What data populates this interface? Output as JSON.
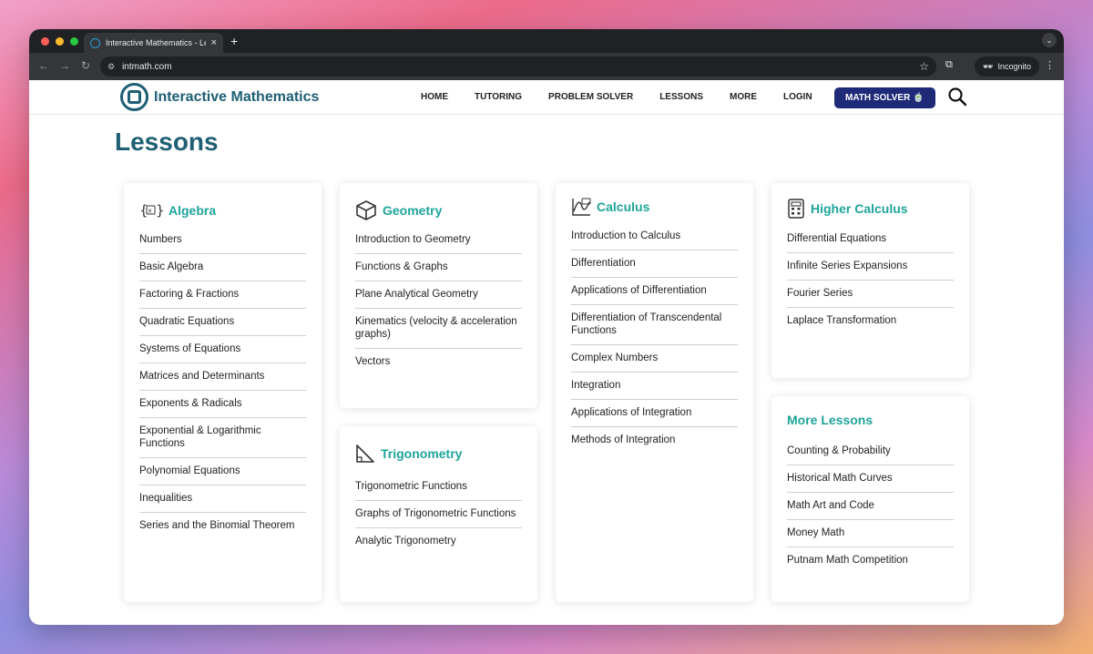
{
  "browser": {
    "tab_title": "Interactive Mathematics - Le",
    "url": "intmath.com",
    "incognito_label": "Incognito"
  },
  "header": {
    "logo_text": "Interactive Mathematics",
    "nav": [
      "HOME",
      "TUTORING",
      "PROBLEM SOLVER",
      "LESSONS",
      "MORE",
      "LOGIN"
    ],
    "cta_label": "MATH SOLVER 🍵"
  },
  "page_title": "Lessons",
  "cards": {
    "algebra": {
      "title": "Algebra",
      "items": [
        "Numbers",
        "Basic Algebra",
        "Factoring & Fractions",
        "Quadratic Equations",
        "Systems of Equations",
        "Matrices and Determinants",
        "Exponents & Radicals",
        "Exponential & Logarithmic Functions",
        "Polynomial Equations",
        "Inequalities",
        "Series and the Binomial Theorem"
      ]
    },
    "geometry": {
      "title": "Geometry",
      "items": [
        "Introduction to Geometry",
        "Functions & Graphs",
        "Plane Analytical Geometry",
        "Kinematics (velocity & acceleration graphs)",
        "Vectors"
      ]
    },
    "trigonometry": {
      "title": "Trigonometry",
      "items": [
        "Trigonometric Functions",
        "Graphs of Trigonometric Functions",
        "Analytic Trigonometry"
      ]
    },
    "calculus": {
      "title": "Calculus",
      "items": [
        "Introduction to Calculus",
        "Differentiation",
        "Applications of Differentiation",
        "Differentiation of Transcendental Functions",
        "Complex Numbers",
        "Integration",
        "Applications of Integration",
        "Methods of Integration"
      ]
    },
    "higher_calculus": {
      "title": "Higher Calculus",
      "items": [
        "Differential Equations",
        "Infinite Series Expansions",
        "Fourier Series",
        "Laplace Transformation"
      ]
    },
    "more_lessons": {
      "title": "More Lessons",
      "items": [
        "Counting & Probability",
        "Historical Math Curves",
        "Math Art and Code",
        "Money Math",
        "Putnam Math Competition"
      ]
    }
  }
}
